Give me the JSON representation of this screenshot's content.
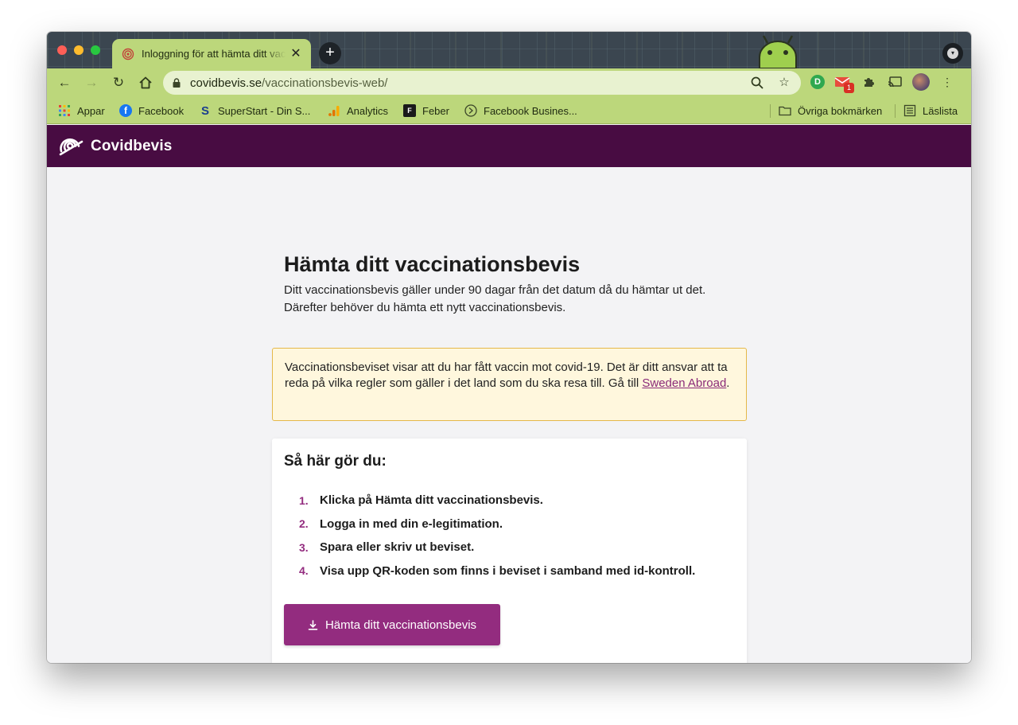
{
  "browser": {
    "tab_title": "Inloggning för att hämta ditt vaccinationsbevis",
    "tab_close": "✕",
    "new_tab": "+",
    "url_domain": "covidbevis.se",
    "url_path": "/vaccinationsbevis-web/",
    "extension_badge": "1",
    "extension_green_letter": "D"
  },
  "bookmarks": {
    "items": [
      {
        "label": "Appar",
        "icon": "apps-grid-icon"
      },
      {
        "label": "Facebook",
        "icon": "facebook-icon"
      },
      {
        "label": "SuperStart - Din S...",
        "icon": "superstart-icon"
      },
      {
        "label": "Analytics",
        "icon": "analytics-icon"
      },
      {
        "label": "Feber",
        "icon": "feber-icon"
      },
      {
        "label": "Facebook Busines...",
        "icon": "facebook-business-icon"
      }
    ],
    "other_label": "Övriga bokmärken",
    "reading_list_label": "Läslista"
  },
  "site": {
    "name": "Covidbevis"
  },
  "page": {
    "title": "Hämta ditt vaccinationsbevis",
    "lead": "Ditt vaccinationsbevis gäller under 90 dagar från det datum då du hämtar ut det. Därefter behöver du hämta ett nytt vaccinationsbevis.",
    "notice": {
      "text": "Vaccinationsbeviset visar att du har fått vaccin mot covid-19. Det är ditt ansvar att ta reda på vilka regler som gäller i det land som du ska resa till. Gå till ",
      "link_text": "Sweden Abroad",
      "after_link": "."
    },
    "card": {
      "title": "Så här gör du:",
      "steps": [
        {
          "num": "1.",
          "text": "Klicka på Hämta ditt vaccinationsbevis."
        },
        {
          "num": "2.",
          "text": "Logga in med din e-legitimation."
        },
        {
          "num": "3.",
          "text": "Spara eller skriv ut beviset."
        },
        {
          "num": "4.",
          "text": "Visa upp QR-koden som finns i beviset i samband med id-kontroll."
        }
      ],
      "button_label": "Hämta ditt vaccinationsbevis"
    }
  },
  "colors": {
    "header_bg": "#480c42",
    "accent": "#932c7f",
    "notice_bg": "#fff7dd",
    "notice_border": "#e5b84a",
    "browser_theme": "#bcd77b"
  }
}
